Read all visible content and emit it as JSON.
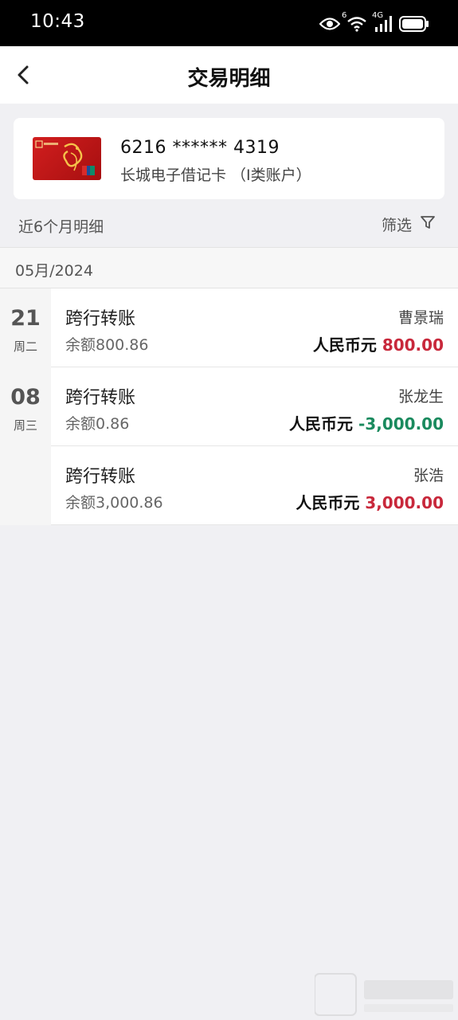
{
  "status_bar": {
    "time": "10:43",
    "icons": [
      "eye-icon",
      "wifi-icon",
      "signal-4g-icon",
      "battery-icon"
    ],
    "wifi_badge": "6",
    "network_badge": "4G"
  },
  "nav": {
    "title": "交易明细",
    "back_icon": "chevron-left-icon"
  },
  "card": {
    "number": "6216 ****** 4319",
    "type": "长城电子借记卡 （I类账户）"
  },
  "range": {
    "label": "近6个月明细",
    "filter_label": "筛选",
    "filter_icon": "funnel-icon"
  },
  "month": "05月/2024",
  "dates": [
    {
      "day": "21",
      "weekday": "周二"
    },
    {
      "day": "08",
      "weekday": "周三"
    }
  ],
  "transactions": [
    {
      "title": "跨行转账",
      "balance": "余额800.86",
      "name": "曹景瑞",
      "currency": "人民币元",
      "amount": "800.00",
      "direction": "in"
    },
    {
      "title": "跨行转账",
      "balance": "余额0.86",
      "name": "张龙生",
      "currency": "人民币元",
      "amount": "-3,000.00",
      "direction": "out"
    },
    {
      "title": "跨行转账",
      "balance": "余额3,000.86",
      "name": "张浩",
      "currency": "人民币元",
      "amount": "3,000.00",
      "direction": "in"
    }
  ],
  "colors": {
    "income": "#c8283b",
    "expense": "#1a8a5e"
  }
}
